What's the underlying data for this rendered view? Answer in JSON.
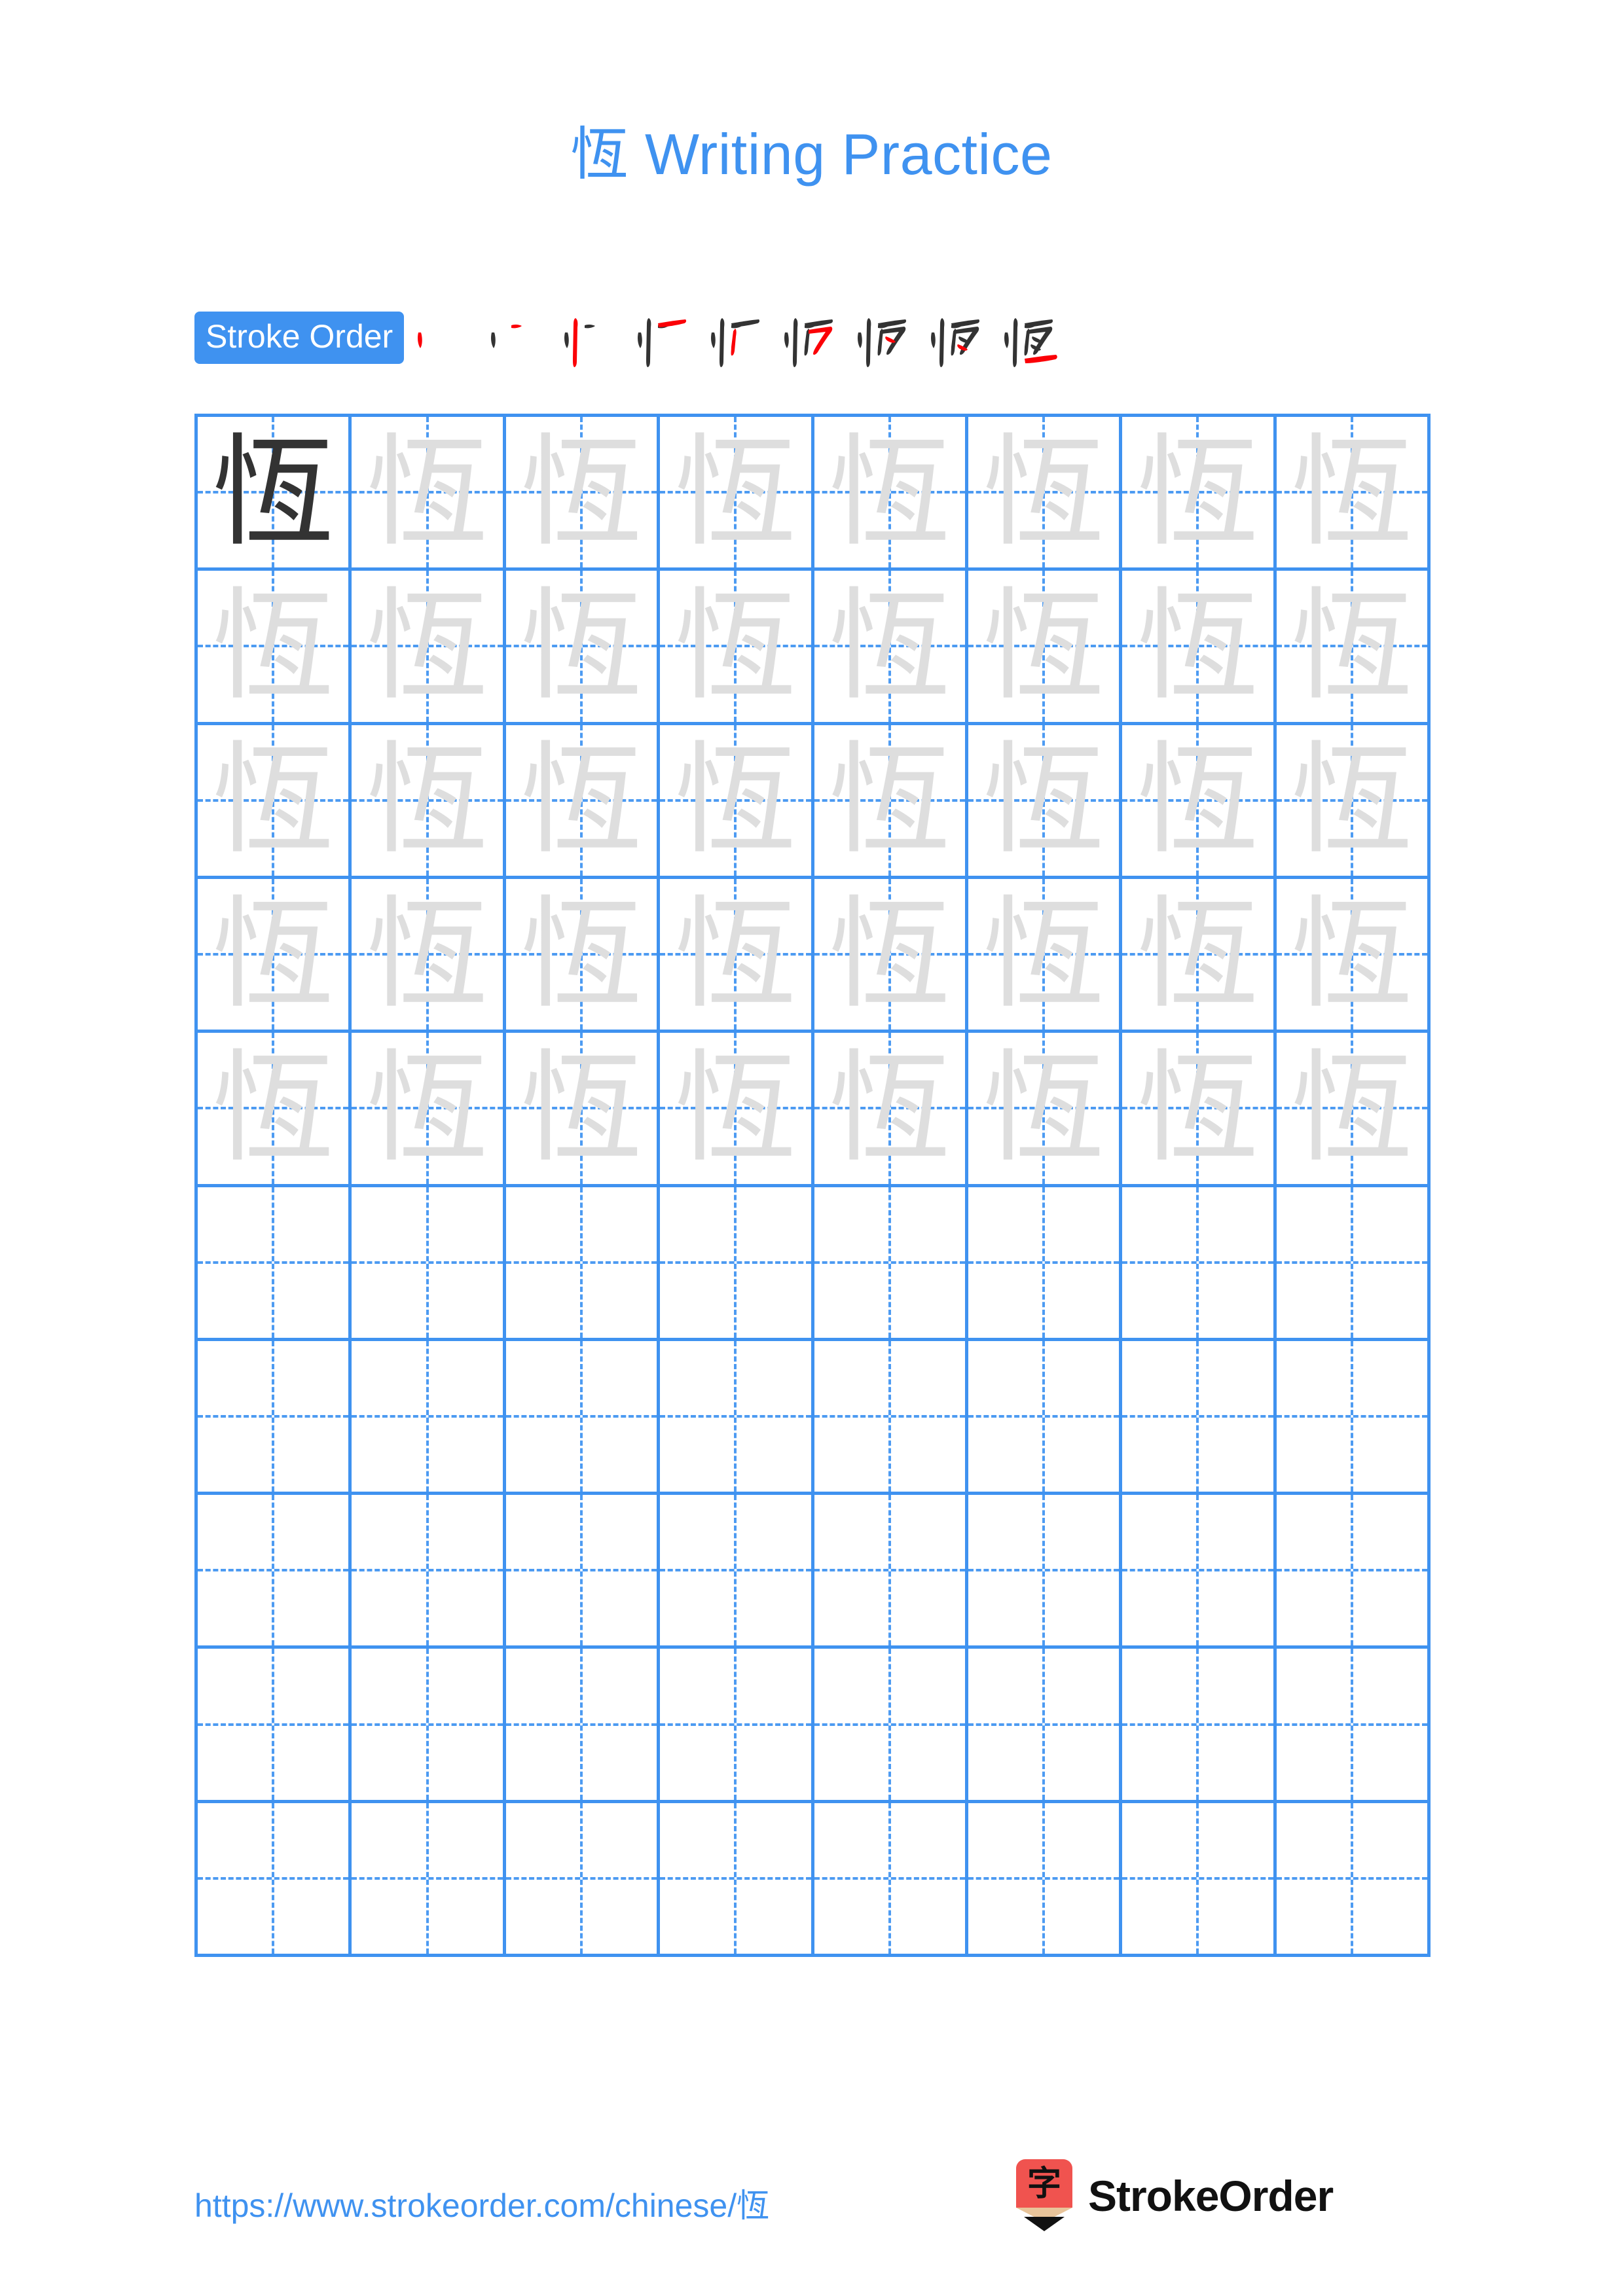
{
  "character": "恆",
  "page": {
    "title_prefix": "恆",
    "title_suffix": " Writing Practice",
    "title_full": "恆 Writing Practice",
    "background_color": "#ffffff"
  },
  "colors": {
    "accent_blue": "#3f92f0",
    "grid_line_blue": "#4d9bf2",
    "stroke_new_red": "#fb0007",
    "stroke_done_black": "#333333",
    "trace_gray": "#dedede",
    "logo_red": "#f0534f",
    "logo_wood": "#e8c49a",
    "logo_text_black": "#111111"
  },
  "stroke_order": {
    "badge_label": "Stroke Order",
    "total_strokes": 9,
    "steps": [
      {
        "index": 1,
        "new_stroke_name": "dot-left"
      },
      {
        "index": 2,
        "new_stroke_name": "tick-right"
      },
      {
        "index": 3,
        "new_stroke_name": "vertical-long"
      },
      {
        "index": 4,
        "new_stroke_name": "horizontal-top"
      },
      {
        "index": 5,
        "new_stroke_name": "vertical-turn"
      },
      {
        "index": 6,
        "new_stroke_name": "hook-right"
      },
      {
        "index": 7,
        "new_stroke_name": "short-slash-upper"
      },
      {
        "index": 8,
        "new_stroke_name": "short-slash-lower"
      },
      {
        "index": 9,
        "new_stroke_name": "horizontal-bottom"
      }
    ]
  },
  "practice_grid": {
    "columns": 8,
    "rows": 10,
    "filled_rows": 5,
    "empty_rows": 5,
    "cells": [
      {
        "glyph": "恆",
        "style": "dark"
      },
      {
        "glyph": "恆",
        "style": "trace"
      },
      {
        "glyph": "恆",
        "style": "trace"
      },
      {
        "glyph": "恆",
        "style": "trace"
      },
      {
        "glyph": "恆",
        "style": "trace"
      },
      {
        "glyph": "恆",
        "style": "trace"
      },
      {
        "glyph": "恆",
        "style": "trace"
      },
      {
        "glyph": "恆",
        "style": "trace"
      },
      {
        "glyph": "恆",
        "style": "trace"
      },
      {
        "glyph": "恆",
        "style": "trace"
      },
      {
        "glyph": "恆",
        "style": "trace"
      },
      {
        "glyph": "恆",
        "style": "trace"
      },
      {
        "glyph": "恆",
        "style": "trace"
      },
      {
        "glyph": "恆",
        "style": "trace"
      },
      {
        "glyph": "恆",
        "style": "trace"
      },
      {
        "glyph": "恆",
        "style": "trace"
      },
      {
        "glyph": "恆",
        "style": "trace"
      },
      {
        "glyph": "恆",
        "style": "trace"
      },
      {
        "glyph": "恆",
        "style": "trace"
      },
      {
        "glyph": "恆",
        "style": "trace"
      },
      {
        "glyph": "恆",
        "style": "trace"
      },
      {
        "glyph": "恆",
        "style": "trace"
      },
      {
        "glyph": "恆",
        "style": "trace"
      },
      {
        "glyph": "恆",
        "style": "trace"
      },
      {
        "glyph": "恆",
        "style": "trace"
      },
      {
        "glyph": "恆",
        "style": "trace"
      },
      {
        "glyph": "恆",
        "style": "trace"
      },
      {
        "glyph": "恆",
        "style": "trace"
      },
      {
        "glyph": "恆",
        "style": "trace"
      },
      {
        "glyph": "恆",
        "style": "trace"
      },
      {
        "glyph": "恆",
        "style": "trace"
      },
      {
        "glyph": "恆",
        "style": "trace"
      },
      {
        "glyph": "恆",
        "style": "trace"
      },
      {
        "glyph": "恆",
        "style": "trace"
      },
      {
        "glyph": "恆",
        "style": "trace"
      },
      {
        "glyph": "恆",
        "style": "trace"
      },
      {
        "glyph": "恆",
        "style": "trace"
      },
      {
        "glyph": "恆",
        "style": "trace"
      },
      {
        "glyph": "恆",
        "style": "trace"
      },
      {
        "glyph": "恆",
        "style": "trace"
      },
      {
        "glyph": "",
        "style": "empty"
      },
      {
        "glyph": "",
        "style": "empty"
      },
      {
        "glyph": "",
        "style": "empty"
      },
      {
        "glyph": "",
        "style": "empty"
      },
      {
        "glyph": "",
        "style": "empty"
      },
      {
        "glyph": "",
        "style": "empty"
      },
      {
        "glyph": "",
        "style": "empty"
      },
      {
        "glyph": "",
        "style": "empty"
      },
      {
        "glyph": "",
        "style": "empty"
      },
      {
        "glyph": "",
        "style": "empty"
      },
      {
        "glyph": "",
        "style": "empty"
      },
      {
        "glyph": "",
        "style": "empty"
      },
      {
        "glyph": "",
        "style": "empty"
      },
      {
        "glyph": "",
        "style": "empty"
      },
      {
        "glyph": "",
        "style": "empty"
      },
      {
        "glyph": "",
        "style": "empty"
      },
      {
        "glyph": "",
        "style": "empty"
      },
      {
        "glyph": "",
        "style": "empty"
      },
      {
        "glyph": "",
        "style": "empty"
      },
      {
        "glyph": "",
        "style": "empty"
      },
      {
        "glyph": "",
        "style": "empty"
      },
      {
        "glyph": "",
        "style": "empty"
      },
      {
        "glyph": "",
        "style": "empty"
      },
      {
        "glyph": "",
        "style": "empty"
      },
      {
        "glyph": "",
        "style": "empty"
      },
      {
        "glyph": "",
        "style": "empty"
      },
      {
        "glyph": "",
        "style": "empty"
      },
      {
        "glyph": "",
        "style": "empty"
      },
      {
        "glyph": "",
        "style": "empty"
      },
      {
        "glyph": "",
        "style": "empty"
      },
      {
        "glyph": "",
        "style": "empty"
      },
      {
        "glyph": "",
        "style": "empty"
      },
      {
        "glyph": "",
        "style": "empty"
      },
      {
        "glyph": "",
        "style": "empty"
      },
      {
        "glyph": "",
        "style": "empty"
      },
      {
        "glyph": "",
        "style": "empty"
      },
      {
        "glyph": "",
        "style": "empty"
      },
      {
        "glyph": "",
        "style": "empty"
      },
      {
        "glyph": "",
        "style": "empty"
      },
      {
        "glyph": "",
        "style": "empty"
      }
    ]
  },
  "footer": {
    "url": "https://www.strokeorder.com/chinese/恆",
    "logo_glyph": "字",
    "logo_text": "StrokeOrder"
  }
}
